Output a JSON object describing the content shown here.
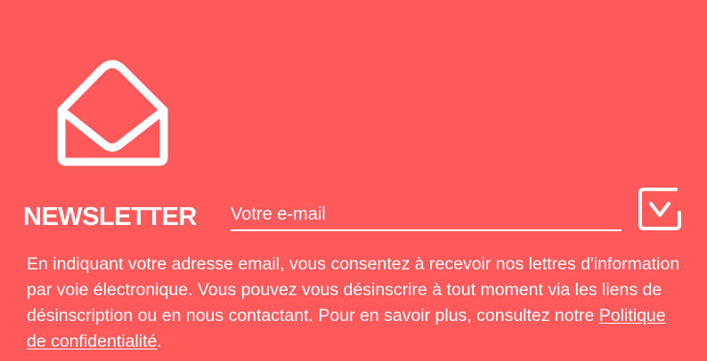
{
  "newsletter": {
    "title": "NEWSLETTER",
    "email_placeholder": "Votre e-mail",
    "email_value": "",
    "submit_icon": "check-icon",
    "envelope_icon": "open-envelope-icon",
    "legal_text": "En indiquant votre adresse email, vous consentez à recevoir nos lettres d'information par voie électronique. Vous pouvez vous désinscrire à tout moment via les liens de désinscription ou en nous contactant. Pour en savoir plus, consultez notre ",
    "privacy_link": "Politique de confidentialité",
    "legal_end": "."
  },
  "colors": {
    "background": "#ff5a5b",
    "foreground": "#ffffff"
  }
}
